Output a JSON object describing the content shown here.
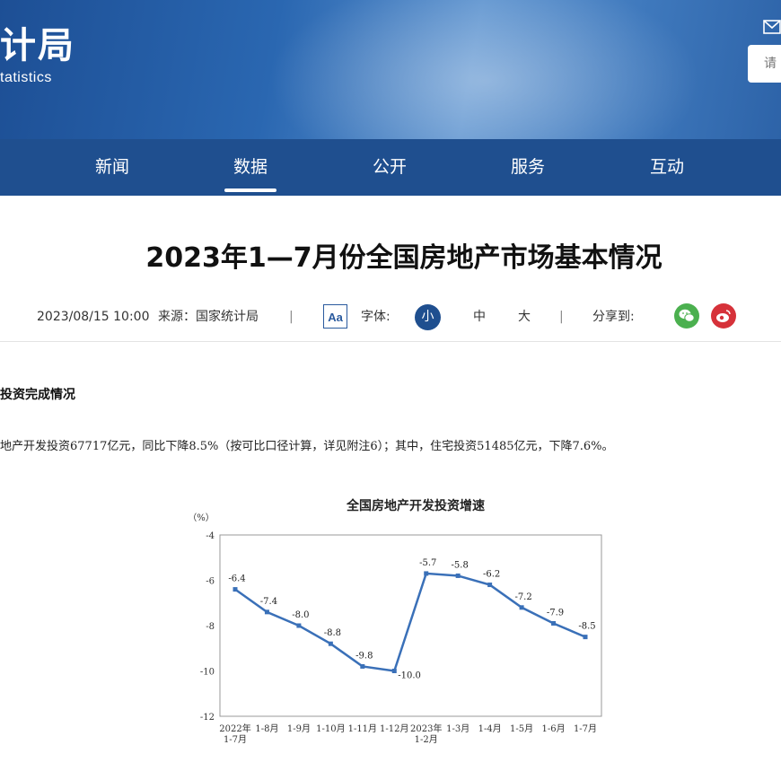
{
  "header": {
    "logo_text": "计局",
    "logo_subtitle": "tatistics",
    "search_placeholder": "请"
  },
  "nav": {
    "items": [
      {
        "label": "新闻"
      },
      {
        "label": "数据"
      },
      {
        "label": "公开"
      },
      {
        "label": "服务"
      },
      {
        "label": "互动"
      }
    ],
    "active": "数据"
  },
  "article": {
    "title": "2023年1—7月份全国房地产市场基本情况",
    "date": "2023/08/15 10:00",
    "source": "来源：国家统计局",
    "font_label": "字体:",
    "font_icon_text": "Aa",
    "font_sizes": [
      "小",
      "中",
      "大"
    ],
    "share_label": "分享到:",
    "divider_symbol": "|",
    "section_heading": "投资完成情况",
    "paragraph": "地产开发投资67717亿元，同比下降8.5%（按可比口径计算，详见附注6）；其中，住宅投资51485亿元，下降7.6%。"
  },
  "colors": {
    "nav_bg": "#1f4f8f",
    "series_line": "#3a70b8",
    "wechat": "#4bb04f",
    "weibo": "#d6323a"
  },
  "chart_data": {
    "type": "line",
    "title": "全国房地产开发投资增速",
    "ylabel": "（%）",
    "ylim": [
      -12,
      -4
    ],
    "yticks": [
      -4,
      -6,
      -8,
      -10,
      -12
    ],
    "grid": false,
    "categories": [
      [
        "2022年",
        "1-7月"
      ],
      [
        "1-8月"
      ],
      [
        "1-9月"
      ],
      [
        "1-10月"
      ],
      [
        "1-11月"
      ],
      [
        "1-12月"
      ],
      [
        "2023年",
        "1-2月"
      ],
      [
        "1-3月"
      ],
      [
        "1-4月"
      ],
      [
        "1-5月"
      ],
      [
        "1-6月"
      ],
      [
        "1-7月"
      ]
    ],
    "values": [
      -6.4,
      -7.4,
      -8.0,
      -8.8,
      -9.8,
      -10.0,
      -5.7,
      -5.8,
      -6.2,
      -7.2,
      -7.9,
      -8.5
    ],
    "labels": [
      "-6.4",
      "-7.4",
      "-8.0",
      "-8.8",
      "-9.8",
      "-10.0",
      "-5.7",
      "-5.8",
      "-6.2",
      "-7.2",
      "-7.9",
      "-8.5"
    ]
  }
}
